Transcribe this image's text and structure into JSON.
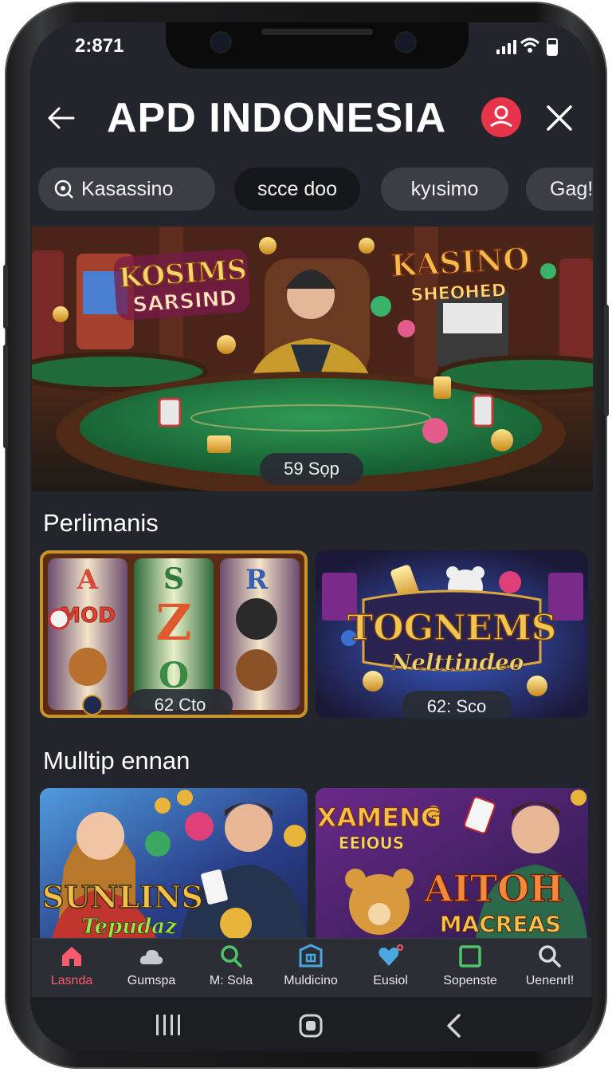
{
  "status": {
    "time": "2:871"
  },
  "header": {
    "title": "APD INDONESIA"
  },
  "chips": [
    {
      "label": "Kasassino",
      "active": false
    },
    {
      "label": "scce doo",
      "active": true
    },
    {
      "label": "kyısimo",
      "active": false
    },
    {
      "label": "Gag!",
      "active": false
    }
  ],
  "hero": {
    "sign_left": [
      "KOSIMS",
      "SARSIND"
    ],
    "sign_right": [
      "KASINO",
      "SHEOHED"
    ],
    "badge": "59 Sọp"
  },
  "sections": [
    {
      "title": "Perlimanis",
      "cards": [
        {
          "art_text": [
            "A",
            "MOD",
            "S",
            "Z",
            "O",
            "R"
          ],
          "badge": "62 Cto"
        },
        {
          "art_text": [
            "TOGNEMS",
            "Nelttindeo"
          ],
          "badge": "62: Sco"
        }
      ]
    },
    {
      "title": "Mulltip ennan",
      "cards": [
        {
          "art_text": [
            "SUNLINS",
            "Tepudaz"
          ]
        },
        {
          "art_text": [
            "XAMENG",
            "EEIOUS",
            "AITOH",
            "MACREAS"
          ]
        }
      ]
    }
  ],
  "bottom_nav": [
    {
      "label": "Lasnda",
      "icon": "home-icon",
      "active": true
    },
    {
      "label": "Gumspa",
      "icon": "cloud-icon",
      "active": false
    },
    {
      "label": "M: Sola",
      "icon": "search-icon",
      "active": false
    },
    {
      "label": "Muldicino",
      "icon": "shield-icon",
      "active": false
    },
    {
      "label": "Eusiol",
      "icon": "heart-icon",
      "active": false
    },
    {
      "label": "Sopenste",
      "icon": "square-icon",
      "active": false
    },
    {
      "label": "Uenenrl!",
      "icon": "search-icon",
      "active": false
    }
  ],
  "colors": {
    "background": "#22252b",
    "accent": "#e8344a",
    "nav_active": "#ff5a6e",
    "chip": "#3b3e44",
    "chip_active": "#15171b"
  }
}
